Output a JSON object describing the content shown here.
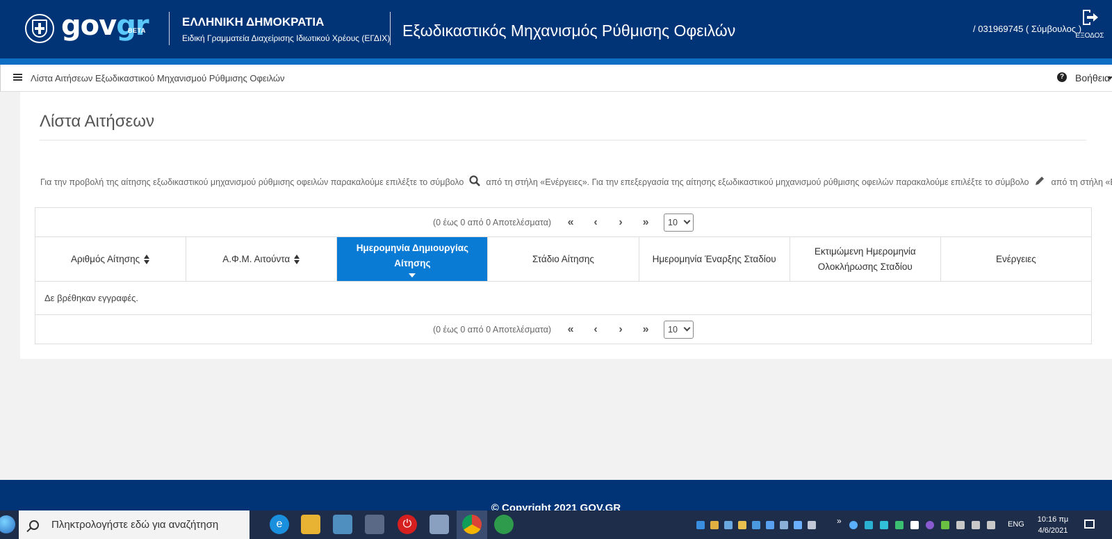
{
  "header": {
    "logo_gov": "gov",
    "logo_gr": "gr",
    "logo_beta": "BETA",
    "republic": "ΕΛΛΗΝΙΚΗ ΔΗΜΟΚΡΑΤΙΑ",
    "secretariat": "Ειδική Γραμματεία Διαχείρισης Ιδιωτικού Χρέους (ΕΓΔΙΧ)",
    "app_title": "Εξωδικαστικός Μηχανισμός Ρύθμισης Οφειλών",
    "user": "/ 031969745 ( Σύμβουλος )",
    "logout_label": "ΕΞΟΔΟΣ",
    "colors": {
      "primary": "#003476",
      "stripe": "#0d6ec4",
      "accent": "#5ac8fa"
    }
  },
  "breadcrumb": {
    "menu_icon": "list-icon",
    "text": "Λίστα Αιτήσεων Εξωδικαστικού Μηχανισμού Ρύθμισης Οφειλών",
    "help_label": "Βοήθεια"
  },
  "page": {
    "title": "Λίστα Αιτήσεων",
    "instructions": {
      "part1": "Για την προβολή της αίτησης εξωδικαστικού μηχανισμού ρύθμισης οφειλών παρακαλούμε επιλέξτε το σύμβολο",
      "part2": "από τη στήλη «Ενέργειες». Για την επεξεργασία της αίτησης εξωδικαστικού μηχανισμού ρύθμισης οφειλών παρακαλούμε επιλέξτε το σύμβολο",
      "part3": "από τη στήλη «Ενέργειες».",
      "icon1": "search-icon",
      "icon2": "pencil-icon"
    }
  },
  "table": {
    "pager": {
      "count_text": "(0 έως 0 από 0 Αποτελέσματα)",
      "first": "«",
      "prev": "‹",
      "next": "›",
      "last": "»",
      "page_size": "10"
    },
    "columns": [
      {
        "label": "Αριθμός Αίτησης",
        "sortable": true
      },
      {
        "label": "Α.Φ.Μ. Αιτούντα",
        "sortable": true
      },
      {
        "label": "Ημερομηνία Δημιουργίας Αίτησης",
        "sortable": true,
        "active": true
      },
      {
        "label": "Στάδιο Αίτησης",
        "sortable": false
      },
      {
        "label": "Ημερομηνία Έναρξης Σταδίου",
        "sortable": false
      },
      {
        "label": "Εκτιμώμενη Ημερομηνία Ολοκλήρωσης Σταδίου",
        "sortable": false
      },
      {
        "label": "Ενέργειες",
        "sortable": false
      }
    ],
    "empty_message": "Δε βρέθηκαν εγγραφές.",
    "active_color": "#0a7bd4"
  },
  "footer": {
    "copyright": "© Copyright 2021 GOV.GR"
  },
  "taskbar": {
    "search_placeholder": "Πληκτρολογήστε εδώ για αναζήτηση",
    "apps": [
      "edge-icon",
      "file-explorer-icon",
      "notepad-icon",
      "calculator-icon",
      "power-icon",
      "store-icon",
      "chrome-icon",
      "app-icon"
    ],
    "chevron": "»",
    "language": "ENG",
    "time": "10:16 πμ",
    "date": "4/6/2021"
  }
}
